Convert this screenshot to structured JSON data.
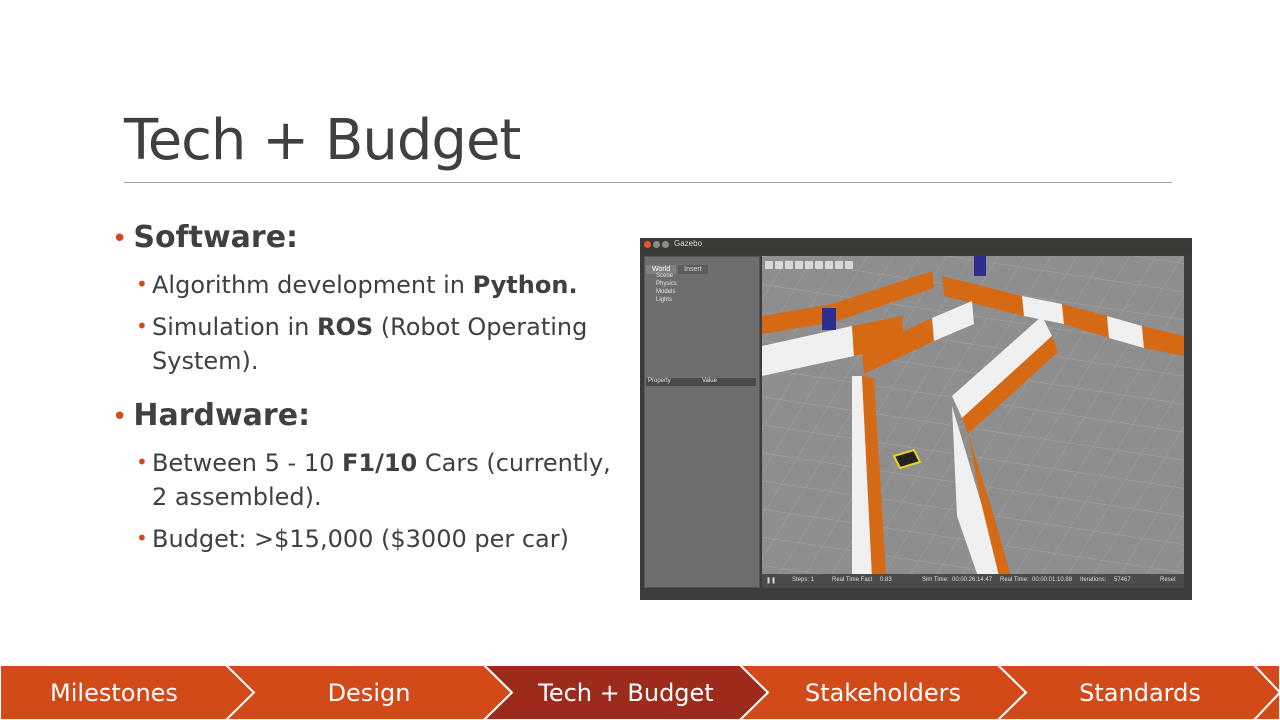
{
  "slide": {
    "title": "Tech + Budget"
  },
  "content": {
    "software_heading": "Software:",
    "software_items": [
      {
        "pre": "Algorithm development in ",
        "bold": "Python.",
        "post": ""
      },
      {
        "pre": "Simulation in ",
        "bold": "ROS",
        "post": " (Robot Operating System)."
      }
    ],
    "hardware_heading": "Hardware:",
    "hardware_items": [
      {
        "pre": "Between 5 - 10 ",
        "bold": "F1/10",
        "post": " Cars (currently, 2 assembled)."
      },
      {
        "pre": "Budget: >$15,000 ($3000 per car)",
        "bold": "",
        "post": ""
      }
    ]
  },
  "screenshot": {
    "window_title": "Gazebo",
    "tabs": [
      "World",
      "Insert"
    ],
    "tree": [
      "Scene",
      "Physics",
      "Models",
      "Lights"
    ],
    "property_cols": [
      "Property",
      "Value"
    ],
    "status": {
      "steps_label": "Steps: 1",
      "rtf_label": "Real Time Fact",
      "rtf_value": "0.83",
      "sim_label": "Sim Time:",
      "sim_value": "00:00:26:14.47",
      "real_label": "Real Time:",
      "real_value": "00:00:01:10.88",
      "iter_label": "Iterations:",
      "iter_value": "57467",
      "reset_label": "Reset"
    }
  },
  "nav": {
    "items": [
      {
        "label": "Milestones",
        "active": false
      },
      {
        "label": "Design",
        "active": false
      },
      {
        "label": "Tech + Budget",
        "active": true
      },
      {
        "label": "Stakeholders",
        "active": false
      },
      {
        "label": "Standards",
        "active": false
      }
    ],
    "color": "#d24a18",
    "active_color": "#9d2b1c"
  }
}
